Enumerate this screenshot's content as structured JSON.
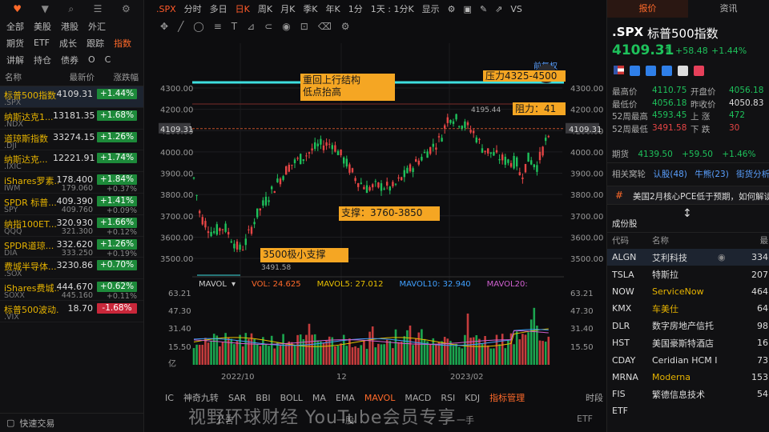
{
  "left": {
    "tabs_row1": [
      "全部",
      "美股",
      "港股",
      "外汇"
    ],
    "tabs_row2": [
      "期货",
      "ETF",
      "成长",
      "跟踪",
      "指数"
    ],
    "tabs_row3": [
      "讲解",
      "持仓",
      "债券",
      "O",
      "C"
    ],
    "active_tab": "指数",
    "col_name": "名称",
    "col_price": "最新价",
    "col_change": "涨跌幅",
    "rows": [
      {
        "name": "标普500指数",
        "code": ".SPX",
        "price": "4109.31",
        "change": "+1.44%",
        "sel": true
      },
      {
        "name": "纳斯达克1...",
        "code": ".NDX",
        "price": "13181.35",
        "change": "+1.68%"
      },
      {
        "name": "道琼斯指数",
        "code": ".DJI",
        "price": "33274.15",
        "change": "+1.26%"
      },
      {
        "name": "纳斯达克...",
        "code": ".IXIC",
        "price": "12221.91",
        "change": "+1.74%"
      },
      {
        "name": "iShares罗素...",
        "code": "IWM",
        "price": "178.400",
        "change": "+1.84%",
        "price2": "179.060",
        "change2": "+0.37%"
      },
      {
        "name": "SPDR 标普...",
        "code": "SPY",
        "price": "409.390",
        "change": "+1.41%",
        "price2": "409.760",
        "change2": "+0.09%"
      },
      {
        "name": "纳指100ET...",
        "code": "QQQ",
        "price": "320.930",
        "change": "+1.66%",
        "price2": "321.300",
        "change2": "+0.12%"
      },
      {
        "name": "SPDR道琼...",
        "code": "DIA",
        "price": "332.620",
        "change": "+1.26%",
        "price2": "333.250",
        "change2": "+0.19%"
      },
      {
        "name": "费城半导体...",
        "code": ".SOX",
        "price": "3230.86",
        "change": "+0.70%"
      },
      {
        "name": "iShares费城...",
        "code": "SOXX",
        "price": "444.670",
        "change": "+0.62%",
        "price2": "445.160",
        "change2": "+0.11%"
      },
      {
        "name": "标普500波动...",
        "code": ".VIX",
        "price": "18.70",
        "change": "-1.68%",
        "neg": true
      }
    ],
    "bottom_label": "快速交易"
  },
  "mid": {
    "toolbar": [
      ".SPX",
      "分时",
      "多日",
      "日K",
      "周K",
      "月K",
      "季K",
      "年K",
      "1分",
      "1天 : 1分K",
      "显示"
    ],
    "active_period": "日K",
    "vs_label": "VS",
    "adjust_label": "前复权",
    "annotations": {
      "a1_line1": "重回上行结构",
      "a1_line2": "低点抬高",
      "a2": "压力4325-4500",
      "a3": "阻力：41",
      "a4": "支撑：3760-3850",
      "a5": "3500极小支撑"
    },
    "price_labels": {
      "high_mark": "4195.44",
      "low_mark": "3491.58",
      "current": "4109.31"
    },
    "volume_legend": {
      "name": "MAVOL",
      "vol_label": "VOL: 24.625",
      "ma5": "MAVOL5: 27.012",
      "ma10": "MAVOL10: 32.940",
      "ma20": "MAVOL20:"
    },
    "vol_axis": [
      "63.21",
      "47.30",
      "31.40",
      "15.50",
      "亿"
    ],
    "price_axis": [
      "4300.00",
      "4200.00",
      "4100.00",
      "4000.00",
      "3900.00",
      "3800.00",
      "3700.00",
      "3600.00",
      "3500.00"
    ],
    "x_labels": [
      "2022/10",
      "12",
      "2023/02"
    ],
    "indicators": [
      "IC",
      "神奇九转",
      "SAR",
      "BBI",
      "BOLL",
      "MA",
      "EMA",
      "MAVOL",
      "MACD",
      "RSI",
      "KDJ",
      "指标管理"
    ],
    "active_indicator": "MAVOL",
    "period_btn": "时段",
    "bottom_items": [
      "公告",
      "一股",
      "一手",
      "ETF"
    ]
  },
  "right": {
    "tabs": [
      "报价",
      "资讯"
    ],
    "symbol": ".SPX",
    "name": "标普500指数",
    "last": "4109.31",
    "chg": "+58.48",
    "pct": "+1.44%",
    "stats": [
      {
        "k": "最高价",
        "v": "4110.75",
        "c": "up",
        "k2": "开盘价",
        "v2": "4056.18",
        "c2": "up"
      },
      {
        "k": "最低价",
        "v": "4056.18",
        "c": "up",
        "k2": "昨收价",
        "v2": "4050.83",
        "c2": ""
      },
      {
        "k": "52周最高",
        "v": "4593.45",
        "c": "up",
        "k2": "上 涨",
        "v2": "472",
        "c2": "up"
      },
      {
        "k": "52周最低",
        "v": "3491.58",
        "c": "dn",
        "k2": "下 跌",
        "v2": "30",
        "c2": "dn"
      }
    ],
    "futures_label": "期货",
    "futures_val": "4139.50",
    "futures_chg": "+59.50",
    "futures_pct": "+1.46%",
    "related_label": "相关窝轮",
    "related_items": [
      "认股(48)",
      "牛熊(23)",
      "街货分析"
    ],
    "news": "美国2月核心PCE低于预期，如何解读",
    "components_label": "成份股",
    "cs_code_head": "代码",
    "cs_name_head": "名称",
    "cs_val_head": "最",
    "components": [
      {
        "code": "ALGN",
        "name": "艾利科技",
        "val": "334",
        "sel": true
      },
      {
        "code": "TSLA",
        "name": "特斯拉",
        "val": "207"
      },
      {
        "code": "NOW",
        "name": "ServiceNow",
        "val": "464"
      },
      {
        "code": "KMX",
        "name": "车美仕",
        "val": "64"
      },
      {
        "code": "DLR",
        "name": "数字房地产信托",
        "val": "98"
      },
      {
        "code": "HST",
        "name": "美国豪斯特酒店",
        "val": "16"
      },
      {
        "code": "CDAY",
        "name": "Ceridian HCM I",
        "val": "73"
      },
      {
        "code": "MRNA",
        "name": "Moderna",
        "val": "153"
      },
      {
        "code": "FIS",
        "name": "繁德信息技术",
        "val": "54"
      }
    ]
  },
  "watermark": "视野环球财经 YouTube会员专享",
  "colors": {
    "up": "#1ec15b",
    "down": "#e64545",
    "accent": "#ff6a2a",
    "annotation": "#f5a623",
    "resistance_line": "#3ee0e0"
  }
}
